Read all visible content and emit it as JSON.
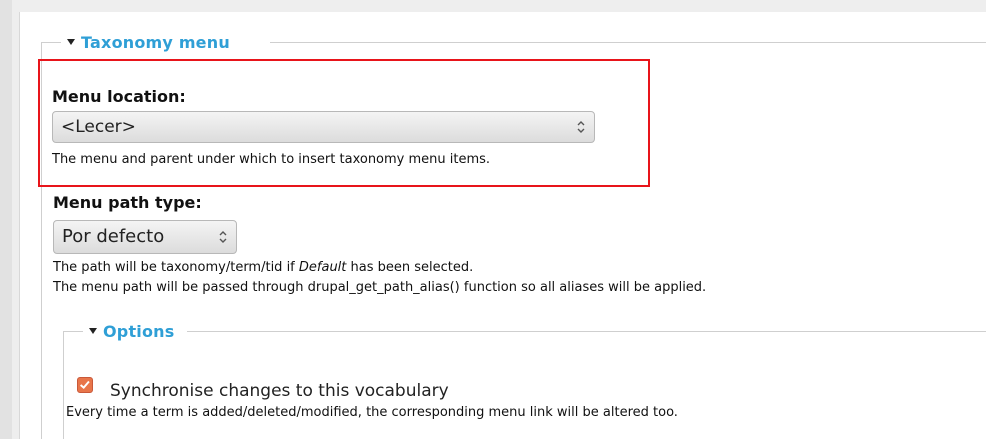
{
  "taxonomy_menu": {
    "legend": "Taxonomy menu",
    "menu_location": {
      "label": "Menu location:",
      "selected": "<Lecer>",
      "description": "The menu and parent under which to insert taxonomy menu items."
    },
    "menu_path_type": {
      "label": "Menu path type:",
      "selected": "Por defecto",
      "description_line1_prefix": "The path will be taxonomy/term/tid if ",
      "description_line1_em": "Default",
      "description_line1_suffix": " has been selected.",
      "description_line2": "The menu path will be passed through drupal_get_path_alias() function so all aliases will be applied."
    }
  },
  "options": {
    "legend": "Options",
    "sync": {
      "label": "Synchronise changes to this vocabulary",
      "checked": true,
      "description": "Every time a term is added/deleted/modified, the corresponding menu link will be altered too."
    }
  },
  "colors": {
    "legend": "#2f9fd6",
    "highlight_border": "#e8141a",
    "checkbox": "#e8754a"
  }
}
